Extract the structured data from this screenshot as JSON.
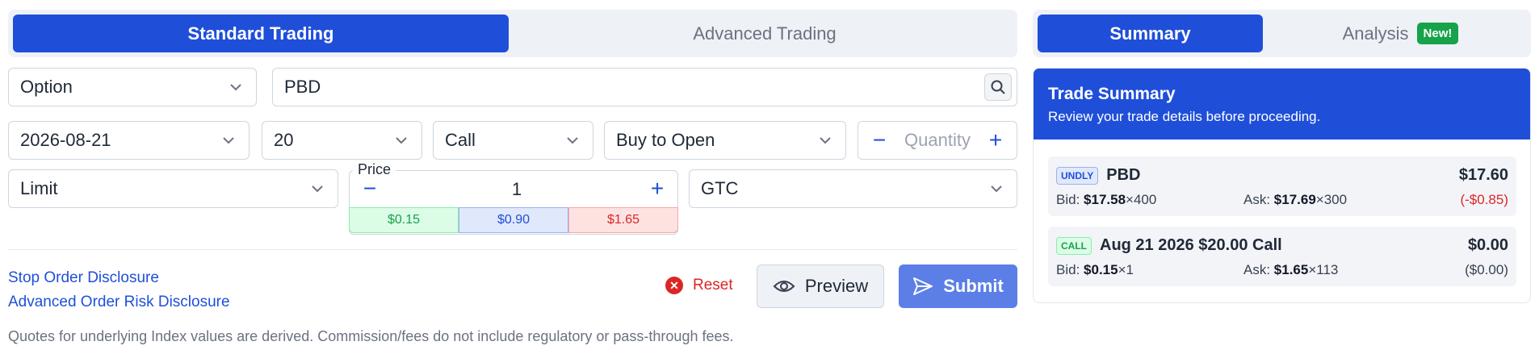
{
  "tabs": {
    "standard": "Standard Trading",
    "advanced": "Advanced Trading"
  },
  "form": {
    "security_type": "Option",
    "symbol": "PBD",
    "expiration": "2026-08-21",
    "strike": "20",
    "option_type": "Call",
    "action": "Buy to Open",
    "quantity_placeholder": "Quantity",
    "order_type": "Limit",
    "price_label": "Price",
    "price_value": "1",
    "price_chips": {
      "bid": "$0.15",
      "mid": "$0.90",
      "ask": "$1.65"
    },
    "time_in_force": "GTC"
  },
  "links": {
    "stop_order": "Stop Order Disclosure",
    "advanced_risk": "Advanced Order Risk Disclosure"
  },
  "actions": {
    "reset": "Reset",
    "preview": "Preview",
    "submit": "Submit"
  },
  "footnote": "Quotes for underlying Index values are derived. Commission/fees do not include regulatory or pass-through fees.",
  "side_tabs": {
    "summary": "Summary",
    "analysis": "Analysis",
    "new_badge": "New!"
  },
  "summary": {
    "title": "Trade Summary",
    "subtitle": "Review your trade details before proceeding.",
    "underlying": {
      "tag": "UNDLY",
      "symbol": "PBD",
      "price": "$17.60",
      "bid_label": "Bid:",
      "bid": "$17.58",
      "bid_size": "×400",
      "ask_label": "Ask:",
      "ask": "$17.69",
      "ask_size": "×300",
      "change": "(-$0.85)"
    },
    "option": {
      "tag": "CALL",
      "description": "Aug 21 2026 $20.00 Call",
      "price": "$0.00",
      "bid_label": "Bid:",
      "bid": "$0.15",
      "bid_size": "×1",
      "ask_label": "Ask:",
      "ask": "$1.65",
      "ask_size": "×113",
      "change": "($0.00)"
    }
  },
  "colors": {
    "primary": "#1f4fd9",
    "submit": "#5b7fe6",
    "danger": "#dc2626",
    "success": "#16a34a"
  }
}
